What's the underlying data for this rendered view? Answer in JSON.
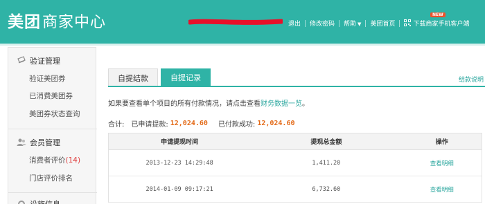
{
  "header": {
    "brand": "美团",
    "subtitle": "商家中心",
    "nav": {
      "logout": "退出",
      "change_password": "修改密码",
      "help": "帮助",
      "meituan_home": "美团首页",
      "download_app": "下载商家手机客户端",
      "new_badge": "NEW"
    },
    "colors": {
      "bar": "#2fb3a6",
      "redaction": "#e8102a",
      "new_badge": "#f0522b"
    }
  },
  "sidebar": {
    "groups": [
      {
        "title": "验证管理",
        "icon": "ticket-icon",
        "items": [
          {
            "label": "验证美团券"
          },
          {
            "label": "已消费美团券"
          },
          {
            "label": "美团券状态查询"
          }
        ]
      },
      {
        "title": "会员管理",
        "icon": "members-icon",
        "items": [
          {
            "label": "消费者评价",
            "count": "(14)"
          },
          {
            "label": "门店评价排名"
          }
        ]
      },
      {
        "title": "设施信息",
        "icon": "settings-icon"
      }
    ]
  },
  "main": {
    "tabs": [
      {
        "label": "自提结款",
        "active": false
      },
      {
        "label": "自提记录",
        "active": true
      }
    ],
    "help_link": "结款说明",
    "info_prefix": "如果要查看单个项目的所有付款情况，请点击查看",
    "info_link": "财务数据一览",
    "info_suffix": "。",
    "totals": {
      "label": "合计:",
      "applied_label": "已申请提款:",
      "applied_value": "12,024.60",
      "paid_label": "已付款成功:",
      "paid_value": "12,024.60"
    },
    "table": {
      "columns": [
        "申请提现时间",
        "提现总金额",
        "操作"
      ],
      "rows": [
        {
          "time": "2013-12-23 14:29:48",
          "amount": "1,411.20",
          "action": "查看明细"
        },
        {
          "time": "2014-01-09 09:17:21",
          "amount": "6,732.60",
          "action": "查看明细"
        }
      ]
    }
  }
}
